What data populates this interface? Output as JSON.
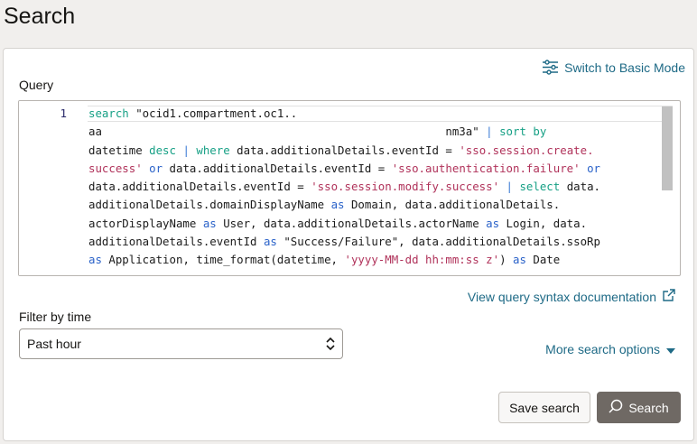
{
  "page": {
    "title": "Search"
  },
  "header": {
    "switch_mode_label": "Switch to Basic Mode"
  },
  "query": {
    "label": "Query",
    "line_number": "1",
    "lines": [
      [
        {
          "t": "search",
          "c": "kw"
        },
        {
          "t": " \"ocid1.compartment.oc1..",
          "c": ""
        }
      ],
      [
        {
          "t": "aa                                                   nm3a\" ",
          "c": ""
        },
        {
          "t": "|",
          "c": "op"
        },
        {
          "t": " ",
          "c": ""
        },
        {
          "t": "sort by",
          "c": "kw"
        }
      ],
      [
        {
          "t": "datetime ",
          "c": ""
        },
        {
          "t": "desc",
          "c": "kw"
        },
        {
          "t": " ",
          "c": ""
        },
        {
          "t": "|",
          "c": "op"
        },
        {
          "t": " ",
          "c": ""
        },
        {
          "t": "where",
          "c": "kw"
        },
        {
          "t": " data.additionalDetails.eventId = ",
          "c": ""
        },
        {
          "t": "'sso.session.create.",
          "c": "str"
        }
      ],
      [
        {
          "t": "success'",
          "c": "str"
        },
        {
          "t": " ",
          "c": ""
        },
        {
          "t": "or",
          "c": "kw2"
        },
        {
          "t": " data.additionalDetails.eventId = ",
          "c": ""
        },
        {
          "t": "'sso.authentication.failure'",
          "c": "str"
        },
        {
          "t": " ",
          "c": ""
        },
        {
          "t": "or",
          "c": "kw2"
        }
      ],
      [
        {
          "t": "data.additionalDetails.eventId = ",
          "c": ""
        },
        {
          "t": "'sso.session.modify.success'",
          "c": "str"
        },
        {
          "t": " ",
          "c": ""
        },
        {
          "t": "|",
          "c": "op"
        },
        {
          "t": " ",
          "c": ""
        },
        {
          "t": "select",
          "c": "kw"
        },
        {
          "t": " data.",
          "c": ""
        }
      ],
      [
        {
          "t": "additionalDetails.domainDisplayName ",
          "c": ""
        },
        {
          "t": "as",
          "c": "kw2"
        },
        {
          "t": " Domain, data.additionalDetails.",
          "c": ""
        }
      ],
      [
        {
          "t": "actorDisplayName ",
          "c": ""
        },
        {
          "t": "as",
          "c": "kw2"
        },
        {
          "t": " User, data.additionalDetails.actorName ",
          "c": ""
        },
        {
          "t": "as",
          "c": "kw2"
        },
        {
          "t": " Login, data.",
          "c": ""
        }
      ],
      [
        {
          "t": "additionalDetails.eventId ",
          "c": ""
        },
        {
          "t": "as",
          "c": "kw2"
        },
        {
          "t": " \"Success/Failure\", data.additionalDetails.ssoRp",
          "c": ""
        }
      ],
      [
        {
          "t": "as",
          "c": "kw2"
        },
        {
          "t": " Application, time_format(datetime, ",
          "c": ""
        },
        {
          "t": "'yyyy-MM-dd hh:mm:ss z'",
          "c": "str"
        },
        {
          "t": ") ",
          "c": ""
        },
        {
          "t": "as",
          "c": "kw2"
        },
        {
          "t": " Date",
          "c": ""
        }
      ]
    ]
  },
  "doc_link": {
    "label": "View query syntax documentation"
  },
  "filter": {
    "label": "Filter by time",
    "selected": "Past hour"
  },
  "more_options": {
    "label": "More search options"
  },
  "actions": {
    "save_label": "Save search",
    "search_label": "Search"
  },
  "colors": {
    "link": "#1e6a86",
    "primary_button": "#6f6964",
    "keyword": "#16a085",
    "keyword_alt": "#2a62c9",
    "string": "#b0325a"
  }
}
